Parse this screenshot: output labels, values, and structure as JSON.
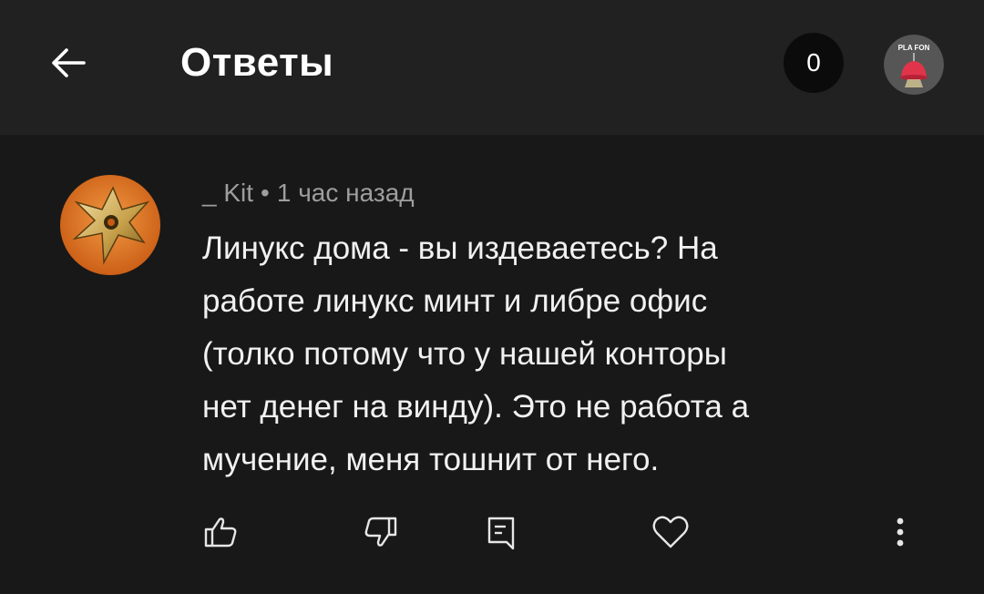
{
  "header": {
    "title": "Ответы",
    "badge_count": "0",
    "channel_logo_text": "PLA FON"
  },
  "comment": {
    "author": "_ Kit",
    "separator": "•",
    "time": "1 час назад",
    "text": "Линукс дома - вы издеваетесь?  На\nработе линукс минт и либре офис\n(толко потому что у нашей конторы\nнет денег на винду).  Это не работа а\nмучение, меня тошнит от  него."
  },
  "icons": {
    "back": "arrow-left-icon",
    "like": "thumb-up-icon",
    "dislike": "thumb-down-icon",
    "reply": "reply-icon",
    "heart": "heart-icon",
    "more": "more-vertical-icon"
  },
  "colors": {
    "background": "#181818",
    "header": "#212121",
    "text": "#f1f1f1",
    "meta": "#9e9e9e",
    "accent_avatar": "#e07a25"
  }
}
